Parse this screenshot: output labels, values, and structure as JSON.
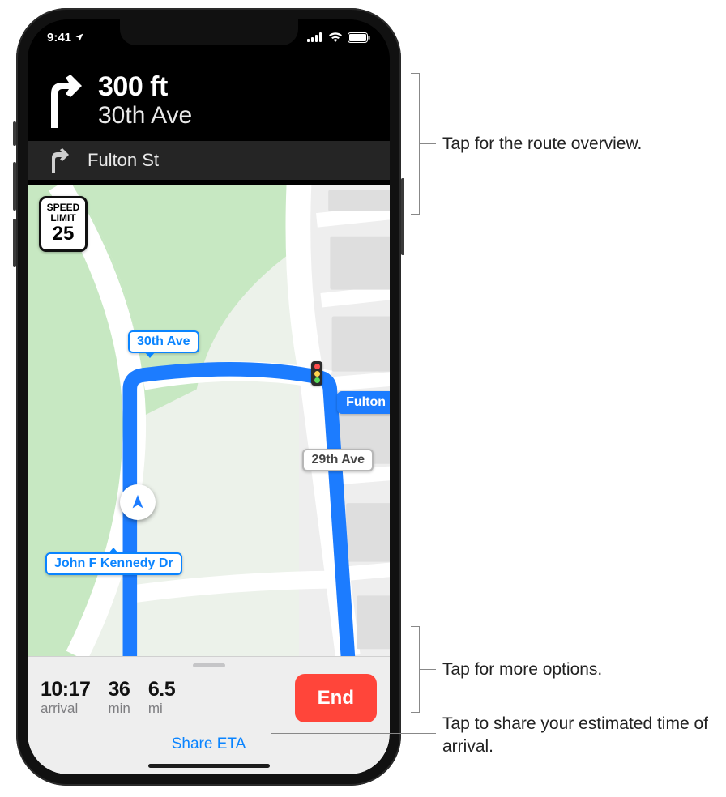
{
  "status": {
    "time": "9:41"
  },
  "direction": {
    "distance": "300 ft",
    "street": "30th Ave",
    "next_street": "Fulton St"
  },
  "speed": {
    "line1": "SPEED",
    "line2": "LIMIT",
    "value": "25"
  },
  "map": {
    "label_30th": "30th Ave",
    "label_fulton": "Fulton",
    "label_29th": "29th Ave",
    "label_jfk": "John F Kennedy Dr"
  },
  "tray": {
    "arrival_time": "10:17",
    "arrival_label": "arrival",
    "duration": "36",
    "duration_label": "min",
    "distance": "6.5",
    "distance_label": "mi",
    "end_label": "End",
    "share_label": "Share ETA"
  },
  "callouts": {
    "route_overview": "Tap for the route overview.",
    "more_options": "Tap for more options.",
    "share_eta": "Tap to share your estimated time of arrival."
  }
}
